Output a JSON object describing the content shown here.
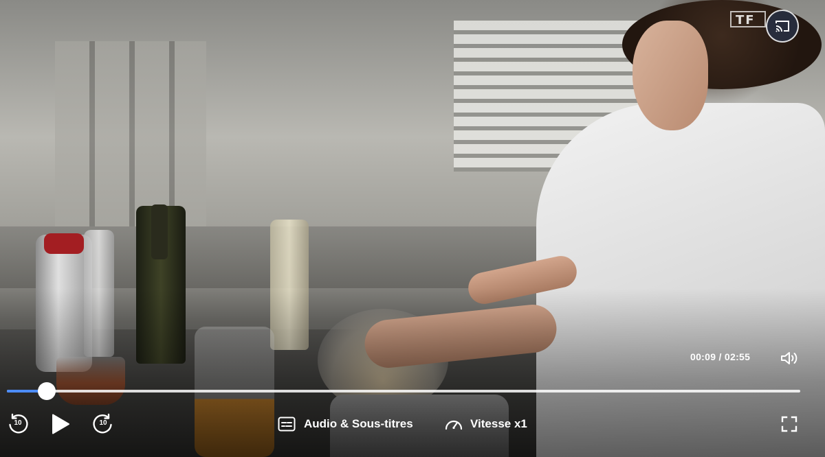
{
  "player": {
    "channel_logo": "TF",
    "time": {
      "current": "00:09",
      "separator": " / ",
      "total": "02:55"
    },
    "progress": 0.05,
    "controls": {
      "rewind_seconds": "10",
      "forward_seconds": "10",
      "audio_subtitles_label": "Audio & Sous-titres",
      "speed_label": "Vitesse x1"
    },
    "icons": [
      "cast-icon",
      "volume-icon",
      "replay-10-icon",
      "play-icon",
      "forward-10-icon",
      "subtitles-icon",
      "speed-gauge-icon",
      "fullscreen-icon"
    ],
    "colors": {
      "progress_fill": "#4d8dff",
      "progress_track": "#ffffff",
      "cast_bg": "#283044"
    }
  }
}
